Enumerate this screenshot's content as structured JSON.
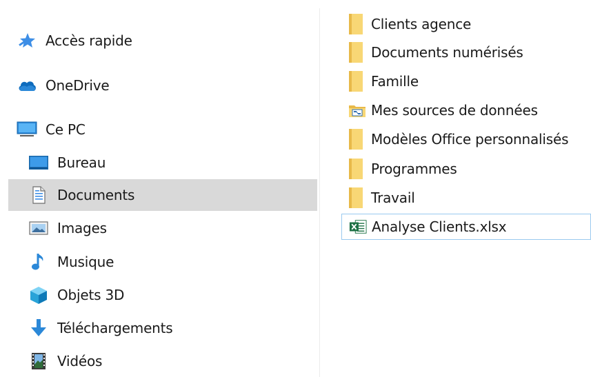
{
  "nav": {
    "quick_access": "Accès rapide",
    "onedrive": "OneDrive",
    "this_pc": "Ce PC",
    "desktop": "Bureau",
    "documents": "Documents",
    "pictures": "Images",
    "music": "Musique",
    "objects_3d": "Objets 3D",
    "downloads": "Téléchargements",
    "videos": "Vidéos",
    "selected": "Documents"
  },
  "files": [
    {
      "name": "Clients agence",
      "icon": "folder-icon"
    },
    {
      "name": "Documents numérisés",
      "icon": "folder-icon"
    },
    {
      "name": "Famille",
      "icon": "folder-icon"
    },
    {
      "name": "Mes sources de données",
      "icon": "data-source-folder-icon"
    },
    {
      "name": "Modèles Office personnalisés",
      "icon": "folder-icon"
    },
    {
      "name": "Programmes",
      "icon": "folder-icon"
    },
    {
      "name": "Travail",
      "icon": "folder-icon"
    },
    {
      "name": "Analyse Clients.xlsx",
      "icon": "excel-file-icon"
    }
  ],
  "colors": {
    "selection": "#d9d9d9",
    "folder": "#f8d775",
    "focus_border": "#99c9ef",
    "excel_green": "#1e7145"
  }
}
